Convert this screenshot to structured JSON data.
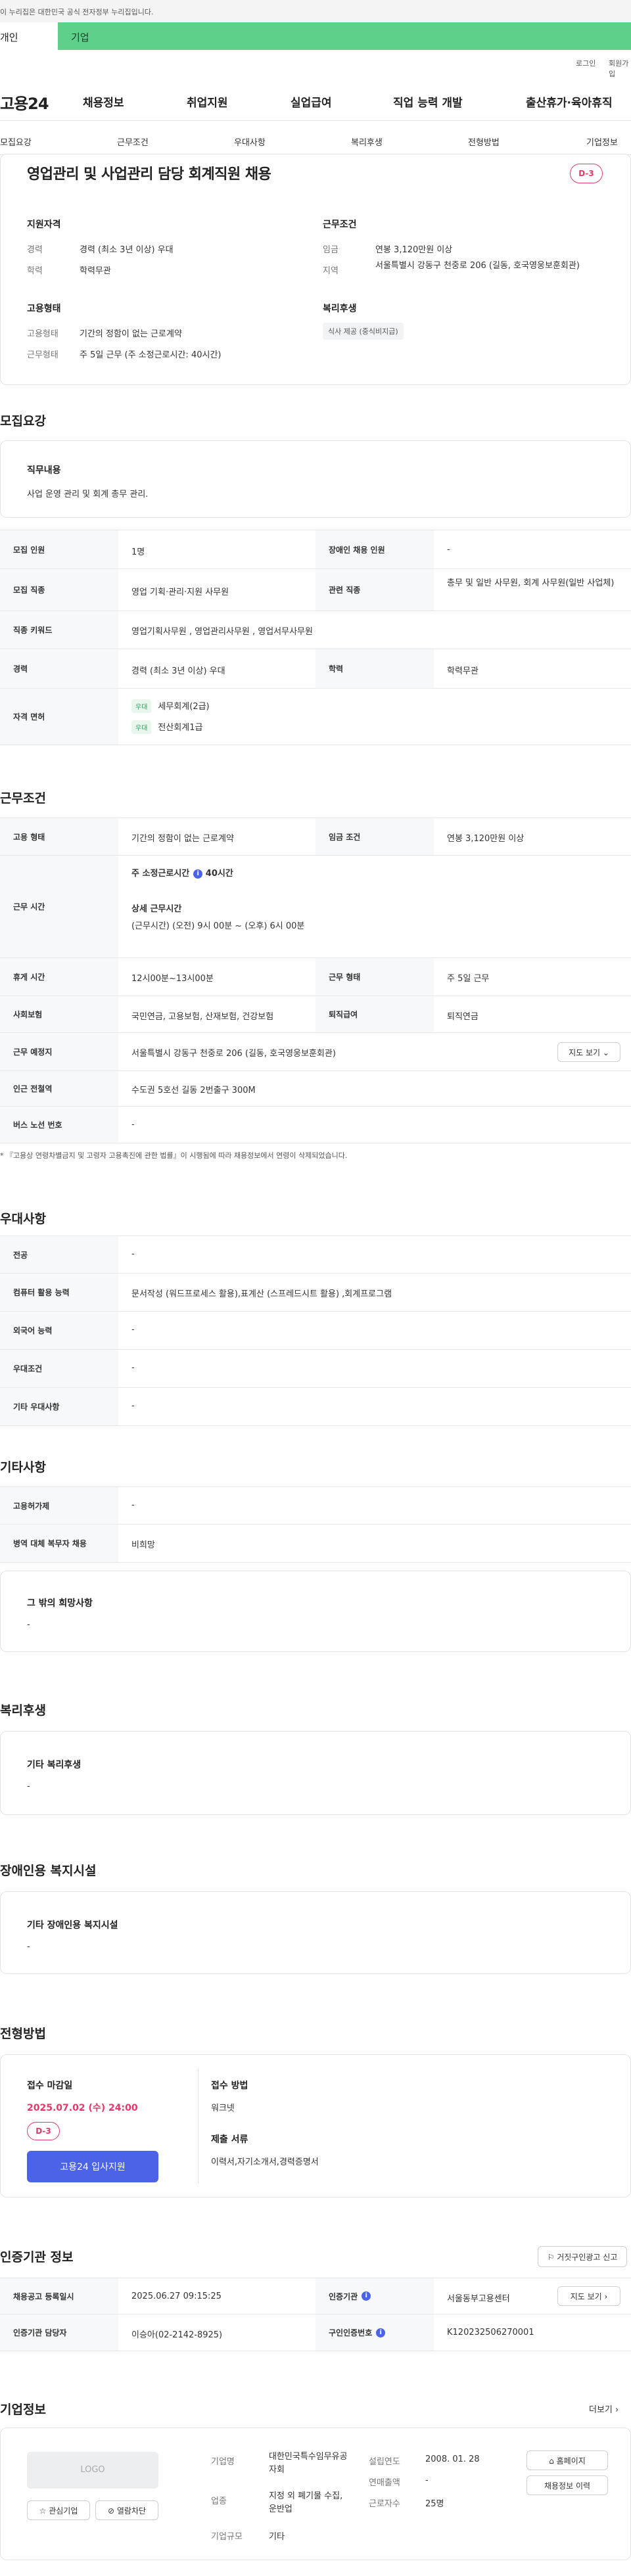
{
  "gov_notice": "이 누리집은 대한민국 공식 전자정부 누리집입니다.",
  "user_tabs": {
    "person": "개인",
    "company": "기업"
  },
  "util": {
    "login": "로그인",
    "join": "회원가입"
  },
  "logo": "고용24",
  "gnb": [
    "채용정보",
    "취업지원",
    "실업급여",
    "직업 능력 개발",
    "출산휴가·육아휴직"
  ],
  "snb": [
    "모집요강",
    "근무조건",
    "우대사항",
    "복리후생",
    "전형방법",
    "기업정보"
  ],
  "summary": {
    "title": "영업관리 및 사업관리 담당 회계직원 채용",
    "dday": "D-3",
    "qual_title": "지원자격",
    "career_label": "경력",
    "career_value": "경력 (최소 3년 이상) 우대",
    "edu_label": "학력",
    "edu_value": "학력무관",
    "cond_title": "근무조건",
    "wage_label": "임금",
    "wage_value": "연봉 3,120만원 이상",
    "region_label": "지역",
    "region_value": "서울특별시 강동구 천중로 206 (길동, 호국영웅보훈회관)",
    "emp_title": "고용형태",
    "emp_label": "고용형태",
    "emp_value": "기간의 정함이 없는 근로계약",
    "work_label": "근무형태",
    "work_value": "주 5일 근무 (주 소정근로시간: 40시간)",
    "welfare_title": "복리후생",
    "welfare_chip": "식사 제공 (중식비지급)"
  },
  "recruit": {
    "heading": "모집요강",
    "duty_title": "직무내용",
    "duty_value": "사업 운영 관리 및 회계 총무 관리.",
    "rows": {
      "count_label": "모집 인원",
      "count_value": "1명",
      "disabled_label": "장애인 채용 인원",
      "disabled_value": "-",
      "job_label": "모집 직종",
      "job_value": "영업 기획·관리·지원 사무원",
      "related_label": "관련 직종",
      "related_value": "총무 및 일반 사무원, 회계 사무원(일반 사업체)",
      "keyword_label": "직종 키워드",
      "keyword_value": "영업기획사무원 , 영업관리사무원 , 영업서무사무원",
      "career_label": "경력",
      "career_value": "경력 (최소 3년 이상) 우대",
      "edu_label": "학력",
      "edu_value": "학력무관",
      "license_label": "자격 면허",
      "license_badge": "우대",
      "license1": "세무회계(2급)",
      "license2": "전산회계1급"
    }
  },
  "work": {
    "heading": "근무조건",
    "emp_label": "고용 형태",
    "emp_value": "기간의 정함이 없는 근로계약",
    "wage_label": "임금 조건",
    "wage_value": "연봉 3,120만원 이상",
    "hours_label": "근무 시간",
    "hours_weekly_prefix": "주 소정근로시간",
    "hours_weekly_value": "40시간",
    "hours_detail_title": "상세 근무시간",
    "hours_detail_value": "(근무시간) (오전) 9시 00분 ~ (오후) 6시 00분",
    "break_label": "휴게 시간",
    "break_value": "12시00분~13시00분",
    "type_label": "근무 형태",
    "type_value": "주 5일 근무",
    "insurance_label": "사회보험",
    "insurance_value": "국민연금, 고용보험, 산재보험, 건강보험",
    "retire_label": "퇴직급여",
    "retire_value": "퇴직연금",
    "place_label": "근무 예정지",
    "place_value": "서울특별시 강동구 천중로 206 (길동, 호국영웅보훈회관)",
    "map_button": "지도 보기",
    "subway_label": "인근 전철역",
    "subway_value": "수도권 5호선 길동 2번출구 300M",
    "bus_label": "버스 노선 번호",
    "bus_value": "-",
    "note": "* 『고용상 연령차별금지 및 고령자 고용촉진에 관한 법률』이 시행됨에 따라 채용정보에서 연령이 삭제되었습니다."
  },
  "prefer": {
    "heading": "우대사항",
    "major_label": "전공",
    "major_value": "-",
    "pc_label": "컴퓨터 활용 능력",
    "pc_value": "문서작성 (워드프로세스 활용),표계산 (스프레드시트 활용) ,회계프로그램",
    "lang_label": "외국어 능력",
    "lang_value": "-",
    "cond_label": "우대조건",
    "cond_value": "-",
    "etc_label": "기타 우대사항",
    "etc_value": "-"
  },
  "other": {
    "heading": "기타사항",
    "visa_label": "고용허가제",
    "visa_value": "-",
    "military_label": "병역 대체 복무자 채용",
    "military_value": "비희망",
    "wish_title": "그 밖의 희망사항",
    "wish_value": "-"
  },
  "welfare": {
    "heading": "복리후생",
    "title": "기타 복리후생",
    "value": "-"
  },
  "facility": {
    "heading": "장애인용 복지시설",
    "title": "기타 장애인용 복지시설",
    "value": "-"
  },
  "selection": {
    "heading": "전형방법",
    "deadline_label": "접수 마감일",
    "deadline_value": "2025.07.02 (수) 24:00",
    "dday": "D-3",
    "apply_button": "고용24 입사지원",
    "method_label": "접수 방법",
    "method_value": "워크넷",
    "docs_label": "제출 서류",
    "docs_value": "이력서,자기소개서,경력증명서"
  },
  "agency": {
    "heading": "인증기관 정보",
    "report_button": "거짓구인광고 신고",
    "reg_label": "채용공고 등록일시",
    "reg_value": "2025.06.27 09:15:25",
    "cert_label": "인증기관",
    "cert_value": "서울동부고용센터",
    "map_button": "지도 보기",
    "manager_label": "인증기관 담당자",
    "manager_value": "이승아(02-2142-8925)",
    "num_label": "구인인증번호",
    "num_value": "K120232506270001"
  },
  "company": {
    "heading": "기업정보",
    "more": "더보기",
    "logo_text": "LOGO",
    "fav_button": "관심기업",
    "block_button": "열람차단",
    "name_label": "기업명",
    "name_value": "대한민국특수임무유공자회",
    "industry_label": "업종",
    "industry_value": "지정 외 폐기물 수집, 운반업",
    "size_label": "기업규모",
    "size_value": "기타",
    "founded_label": "설립연도",
    "founded_value": "2008. 01. 28",
    "sales_label": "연매출액",
    "sales_value": "-",
    "employees_label": "근로자수",
    "employees_value": "25명",
    "home_button": "홈페이지",
    "history_button": "채용정보 이력"
  }
}
